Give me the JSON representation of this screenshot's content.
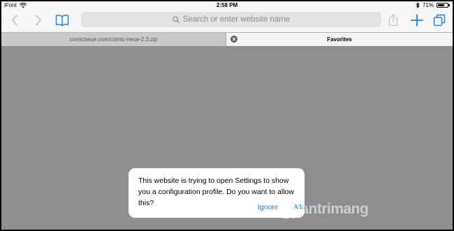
{
  "status_bar": {
    "carrier": "iFont",
    "time": "2:58 PM",
    "battery_percent": "71%",
    "battery_level": 0.71
  },
  "toolbar": {
    "back_icon": "chevron-left-icon",
    "forward_icon": "chevron-right-icon",
    "bookmarks_icon": "book-icon",
    "share_icon": "share-icon",
    "new_tab_icon": "plus-icon",
    "tabs_icon": "tabs-icon",
    "accent_color": "#1a7cf5"
  },
  "address_bar": {
    "placeholder": "Search or enter website name"
  },
  "tabs": [
    {
      "title": "comicneue.com/comic-neue-2.3.zip",
      "active": false
    },
    {
      "title": "Favorites",
      "active": true
    }
  ],
  "dialog": {
    "message": "This website is trying to open Settings to show you a configuration profile. Do you want to allow this?",
    "ignore_label": "Ignore",
    "allow_label": "Allow",
    "button_color": "#2b7de0"
  },
  "watermark": {
    "text": "uantrimang"
  }
}
